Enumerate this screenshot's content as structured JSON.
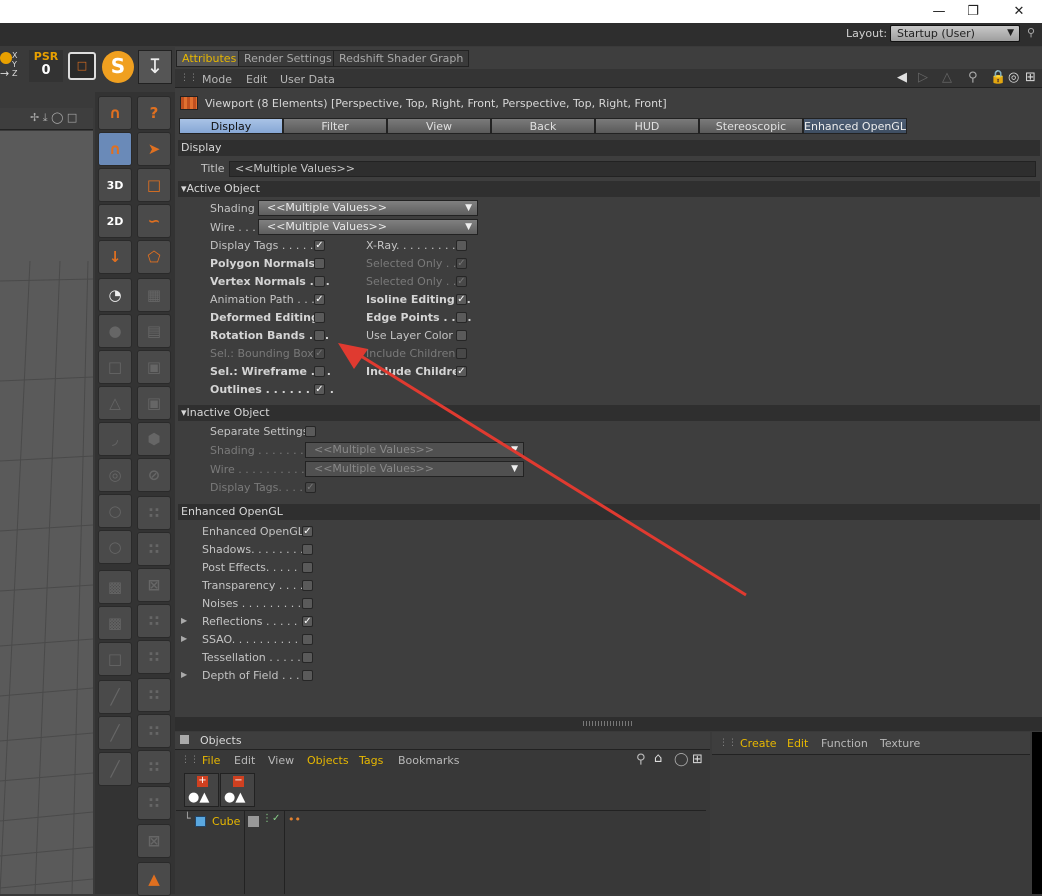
{
  "window": {
    "restore_icon": "restore-icon",
    "close_icon": "close-icon",
    "minimize_icon": "minimize-icon"
  },
  "layout": {
    "label": "Layout:",
    "value": "Startup (User)"
  },
  "toolbar_top": {
    "psr_label": "PSR",
    "psr_value": "0",
    "axis_labels": [
      "X",
      "Y",
      "Z"
    ]
  },
  "left_tools": [
    "3D",
    "2D"
  ],
  "tabs": [
    "Attributes",
    "Render Settings",
    "Redshift Shader Graph"
  ],
  "menu": [
    "Mode",
    "Edit",
    "User Data"
  ],
  "object_info": "Viewport (8 Elements) [Perspective, Top, Right, Front, Perspective, Top, Right, Front]",
  "subtabs": [
    "Display",
    "Filter",
    "View",
    "Back",
    "HUD",
    "Stereoscopic",
    "Enhanced OpenGL"
  ],
  "display": {
    "section": "Display",
    "title_label": "Title",
    "title_value": "<<Multiple Values>>"
  },
  "active_object": {
    "section": "Active Object",
    "shading_label": "Shading",
    "shading_value": "<<Multiple Values>>",
    "wire_label": "Wire . . .",
    "wire_value": "<<Multiple Values>>",
    "left": [
      {
        "label": "Display Tags . . . . . .",
        "checked": true,
        "bold": false,
        "dim": false
      },
      {
        "label": "Polygon Normals",
        "checked": false,
        "bold": true,
        "dim": false
      },
      {
        "label": "Vertex Normals . . .",
        "checked": false,
        "bold": true,
        "dim": false
      },
      {
        "label": "Animation Path . . .",
        "checked": true,
        "bold": false,
        "dim": false
      },
      {
        "label": "Deformed Editing",
        "checked": false,
        "bold": true,
        "dim": false
      },
      {
        "label": "Rotation Bands . . .",
        "checked": false,
        "bold": true,
        "dim": false
      },
      {
        "label": "Sel.: Bounding Box",
        "checked": true,
        "bold": false,
        "dim": true
      },
      {
        "label": "Sel.: Wireframe . . .",
        "checked": false,
        "bold": true,
        "dim": false
      },
      {
        "label": "Outlines . . . . . . . . .",
        "checked": true,
        "bold": true,
        "dim": false
      }
    ],
    "right": [
      {
        "label": "X-Ray. . . . . . . . . .",
        "checked": false,
        "bold": false,
        "dim": false
      },
      {
        "label": "Selected Only . . .",
        "checked": true,
        "bold": false,
        "dim": true
      },
      {
        "label": "Selected Only . . .",
        "checked": true,
        "bold": false,
        "dim": true
      },
      {
        "label": "Isoline Editing . .",
        "checked": true,
        "bold": true,
        "dim": false
      },
      {
        "label": "Edge Points . . . .",
        "checked": false,
        "bold": true,
        "dim": false
      },
      {
        "label": "Use Layer Color",
        "checked": false,
        "bold": false,
        "dim": false
      },
      {
        "label": "Include Children",
        "checked": false,
        "bold": false,
        "dim": true
      },
      {
        "label": "Include Children",
        "checked": true,
        "bold": true,
        "dim": false
      }
    ]
  },
  "inactive_object": {
    "section": "Inactive Object",
    "separate_label": "Separate Settings",
    "shading_label": "Shading . . . . . . .",
    "shading_value": "<<Multiple Values>>",
    "wire_label": "Wire . . . . . . . . . .",
    "wire_value": "<<Multiple Values>>",
    "tags_label": "Display Tags. . . ."
  },
  "enhanced_opengl": {
    "section": "Enhanced OpenGL",
    "items": [
      {
        "label": "Enhanced OpenGL",
        "checked": true,
        "expand": false
      },
      {
        "label": "Shadows. . . . . . . . .",
        "checked": false,
        "expand": false
      },
      {
        "label": "Post Effects. . . . . .",
        "checked": false,
        "expand": false
      },
      {
        "label": "Transparency . . . .",
        "checked": false,
        "expand": false
      },
      {
        "label": "Noises . . . . . . . . . .",
        "checked": false,
        "expand": false
      },
      {
        "label": "Reflections . . . . . .",
        "checked": true,
        "expand": true
      },
      {
        "label": "SSAO. . . . . . . . . . .",
        "checked": false,
        "expand": true
      },
      {
        "label": "Tessellation . . . . .",
        "checked": false,
        "expand": false
      },
      {
        "label": "Depth of Field . . .",
        "checked": false,
        "expand": true
      }
    ]
  },
  "objects_panel": {
    "title": "Objects",
    "menu": [
      "File",
      "Edit",
      "View",
      "Objects",
      "Tags",
      "Bookmarks"
    ],
    "object_name": "Cube"
  },
  "layers_panel": {
    "menu": [
      "Create",
      "Edit",
      "Function",
      "Texture"
    ]
  }
}
